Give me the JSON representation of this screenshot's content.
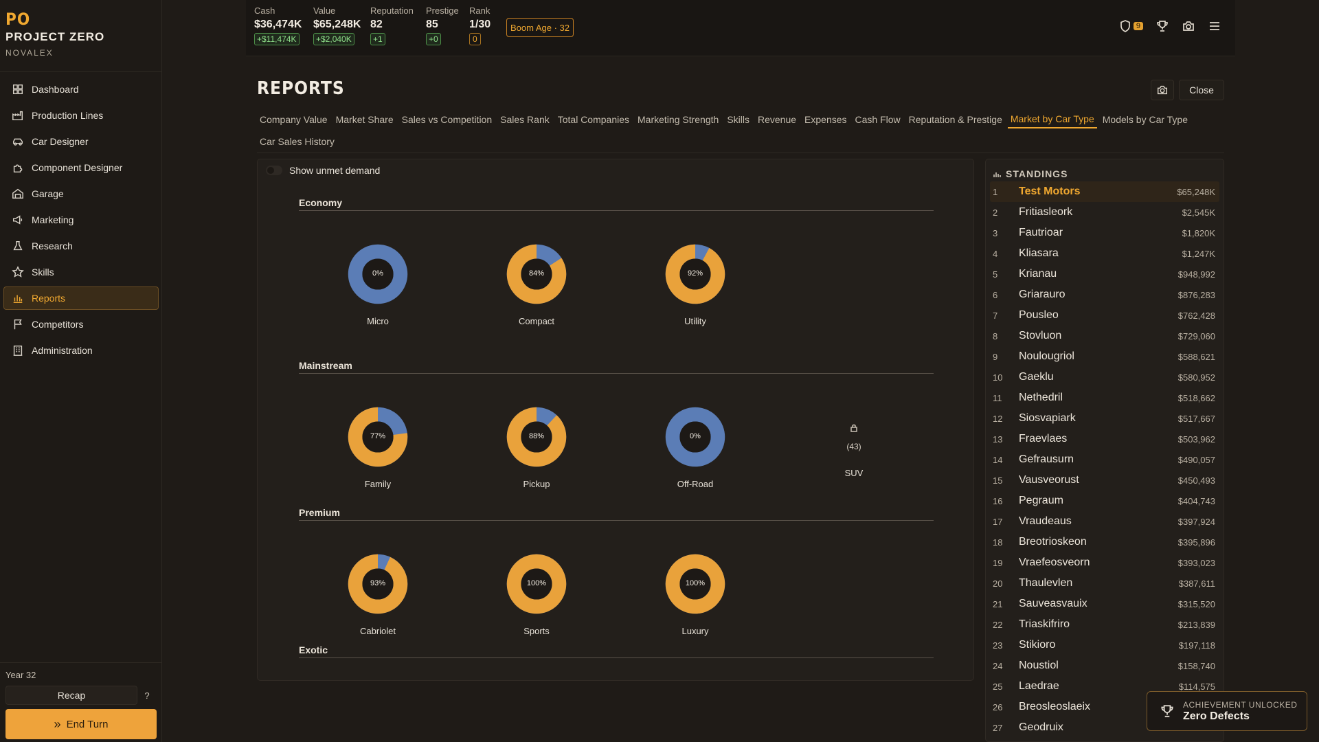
{
  "brand": {
    "logo": "PO",
    "name": "PROJECT ZERO",
    "studio": "NOVALEX"
  },
  "nav": [
    {
      "label": "Dashboard",
      "icon": "dashboard-icon"
    },
    {
      "label": "Production Lines",
      "icon": "factory-icon"
    },
    {
      "label": "Car Designer",
      "icon": "car-icon"
    },
    {
      "label": "Component Designer",
      "icon": "puzzle-icon"
    },
    {
      "label": "Garage",
      "icon": "garage-icon"
    },
    {
      "label": "Marketing",
      "icon": "megaphone-icon"
    },
    {
      "label": "Research",
      "icon": "flask-icon"
    },
    {
      "label": "Skills",
      "icon": "star-icon"
    },
    {
      "label": "Reports",
      "icon": "bar-chart-icon",
      "active": true
    },
    {
      "label": "Competitors",
      "icon": "flag-icon"
    },
    {
      "label": "Administration",
      "icon": "building-icon"
    }
  ],
  "sidebar_bottom": {
    "year": "Year 32",
    "recap": "Recap",
    "help": "?",
    "end_turn": "End Turn"
  },
  "topbar": {
    "cash": {
      "label": "Cash",
      "value": "$36,474K",
      "delta": "+$11,474K"
    },
    "value": {
      "label": "Value",
      "value": "$65,248K",
      "delta": "+$2,040K"
    },
    "reputation": {
      "label": "Reputation",
      "value": "82",
      "delta": "+1"
    },
    "prestige": {
      "label": "Prestige",
      "value": "85",
      "delta": "+0"
    },
    "rank": {
      "label": "Rank",
      "value": "1/30",
      "delta": "0"
    },
    "era": "Boom Age · 32",
    "shield_count": "9"
  },
  "page": {
    "title": "REPORTS",
    "close": "Close"
  },
  "tabs": [
    [
      "Company Value",
      "Market Share",
      "Sales vs Competition",
      "Sales Rank",
      "Total Companies",
      "Marketing Strength",
      "Skills",
      "Revenue",
      "Expenses",
      "Cash Flow",
      "Reputation & Prestige",
      "Market by Car Type",
      "Models by Car Type"
    ],
    [
      "Car Sales History"
    ]
  ],
  "active_tab": "Market by Car Type",
  "panel": {
    "toggle_label": "Show unmet demand",
    "sections": [
      {
        "name": "Economy",
        "items": [
          {
            "name": "Micro",
            "pct": 0,
            "label": "0%"
          },
          {
            "name": "Compact",
            "pct": 84,
            "label": "84%"
          },
          {
            "name": "Utility",
            "pct": 92,
            "label": "92%"
          }
        ]
      },
      {
        "name": "Mainstream",
        "items": [
          {
            "name": "Family",
            "pct": 77,
            "label": "77%"
          },
          {
            "name": "Pickup",
            "pct": 88,
            "label": "88%"
          },
          {
            "name": "Off-Road",
            "pct": 0,
            "label": "0%"
          },
          {
            "name": "SUV",
            "locked": true,
            "count": "(43)"
          }
        ]
      },
      {
        "name": "Premium",
        "items": [
          {
            "name": "Cabriolet",
            "pct": 93,
            "label": "93%"
          },
          {
            "name": "Sports",
            "pct": 100,
            "label": "100%"
          },
          {
            "name": "Luxury",
            "pct": 100,
            "label": "100%"
          }
        ]
      },
      {
        "name": "Exotic",
        "items": []
      }
    ],
    "colors": {
      "player": "#e9a23b",
      "others": "#5b7db6"
    }
  },
  "standings": {
    "title": "STANDINGS",
    "rows": [
      {
        "rank": "1",
        "name": "Test Motors",
        "value": "$65,248K",
        "me": true
      },
      {
        "rank": "2",
        "name": "Fritiasleork",
        "value": "$2,545K"
      },
      {
        "rank": "3",
        "name": "Fautrioar",
        "value": "$1,820K"
      },
      {
        "rank": "4",
        "name": "Kliasara",
        "value": "$1,247K"
      },
      {
        "rank": "5",
        "name": "Krianau",
        "value": "$948,992"
      },
      {
        "rank": "6",
        "name": "Griarauro",
        "value": "$876,283"
      },
      {
        "rank": "7",
        "name": "Pousleo",
        "value": "$762,428"
      },
      {
        "rank": "8",
        "name": "Stovluon",
        "value": "$729,060"
      },
      {
        "rank": "9",
        "name": "Noulougriol",
        "value": "$588,621"
      },
      {
        "rank": "10",
        "name": "Gaeklu",
        "value": "$580,952"
      },
      {
        "rank": "11",
        "name": "Nethedril",
        "value": "$518,662"
      },
      {
        "rank": "12",
        "name": "Siosvapiark",
        "value": "$517,667"
      },
      {
        "rank": "13",
        "name": "Fraevlaes",
        "value": "$503,962"
      },
      {
        "rank": "14",
        "name": "Gefrausurn",
        "value": "$490,057"
      },
      {
        "rank": "15",
        "name": "Vausveorust",
        "value": "$450,493"
      },
      {
        "rank": "16",
        "name": "Pegraum",
        "value": "$404,743"
      },
      {
        "rank": "17",
        "name": "Vraudeaus",
        "value": "$397,924"
      },
      {
        "rank": "18",
        "name": "Breotrioskeon",
        "value": "$395,896"
      },
      {
        "rank": "19",
        "name": "Vraefeosveorn",
        "value": "$393,023"
      },
      {
        "rank": "20",
        "name": "Thaulevlen",
        "value": "$387,611"
      },
      {
        "rank": "21",
        "name": "Sauveasvauix",
        "value": "$315,520"
      },
      {
        "rank": "22",
        "name": "Triaskifriro",
        "value": "$213,839"
      },
      {
        "rank": "23",
        "name": "Stikioro",
        "value": "$197,118"
      },
      {
        "rank": "24",
        "name": "Noustiol",
        "value": "$158,740"
      },
      {
        "rank": "25",
        "name": "Laedrae",
        "value": "$114,575"
      },
      {
        "rank": "26",
        "name": "Breosleoslaeix",
        "value": ""
      },
      {
        "rank": "27",
        "name": "Geodruix",
        "value": ""
      }
    ]
  },
  "toast": {
    "line1": "ACHIEVEMENT UNLOCKED",
    "line2": "Zero Defects"
  }
}
